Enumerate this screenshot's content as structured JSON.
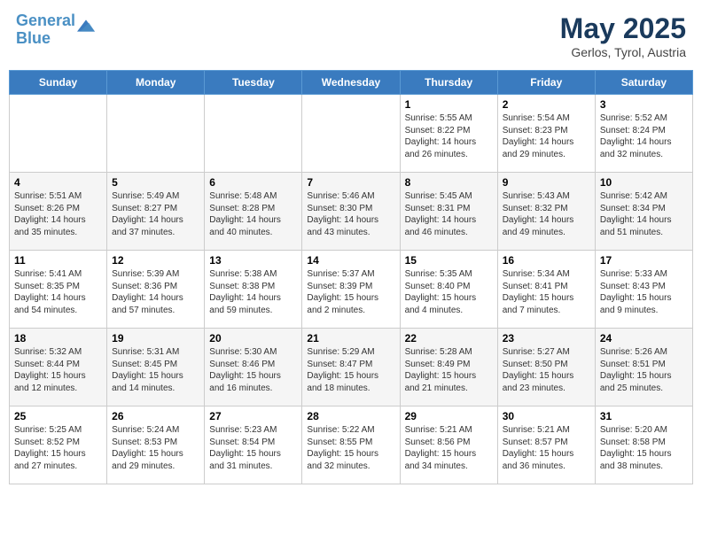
{
  "header": {
    "logo_line1": "General",
    "logo_line2": "Blue",
    "month": "May 2025",
    "location": "Gerlos, Tyrol, Austria"
  },
  "days_of_week": [
    "Sunday",
    "Monday",
    "Tuesday",
    "Wednesday",
    "Thursday",
    "Friday",
    "Saturday"
  ],
  "weeks": [
    [
      {
        "day": "",
        "info": ""
      },
      {
        "day": "",
        "info": ""
      },
      {
        "day": "",
        "info": ""
      },
      {
        "day": "",
        "info": ""
      },
      {
        "day": "1",
        "info": "Sunrise: 5:55 AM\nSunset: 8:22 PM\nDaylight: 14 hours and 26 minutes."
      },
      {
        "day": "2",
        "info": "Sunrise: 5:54 AM\nSunset: 8:23 PM\nDaylight: 14 hours and 29 minutes."
      },
      {
        "day": "3",
        "info": "Sunrise: 5:52 AM\nSunset: 8:24 PM\nDaylight: 14 hours and 32 minutes."
      }
    ],
    [
      {
        "day": "4",
        "info": "Sunrise: 5:51 AM\nSunset: 8:26 PM\nDaylight: 14 hours and 35 minutes."
      },
      {
        "day": "5",
        "info": "Sunrise: 5:49 AM\nSunset: 8:27 PM\nDaylight: 14 hours and 37 minutes."
      },
      {
        "day": "6",
        "info": "Sunrise: 5:48 AM\nSunset: 8:28 PM\nDaylight: 14 hours and 40 minutes."
      },
      {
        "day": "7",
        "info": "Sunrise: 5:46 AM\nSunset: 8:30 PM\nDaylight: 14 hours and 43 minutes."
      },
      {
        "day": "8",
        "info": "Sunrise: 5:45 AM\nSunset: 8:31 PM\nDaylight: 14 hours and 46 minutes."
      },
      {
        "day": "9",
        "info": "Sunrise: 5:43 AM\nSunset: 8:32 PM\nDaylight: 14 hours and 49 minutes."
      },
      {
        "day": "10",
        "info": "Sunrise: 5:42 AM\nSunset: 8:34 PM\nDaylight: 14 hours and 51 minutes."
      }
    ],
    [
      {
        "day": "11",
        "info": "Sunrise: 5:41 AM\nSunset: 8:35 PM\nDaylight: 14 hours and 54 minutes."
      },
      {
        "day": "12",
        "info": "Sunrise: 5:39 AM\nSunset: 8:36 PM\nDaylight: 14 hours and 57 minutes."
      },
      {
        "day": "13",
        "info": "Sunrise: 5:38 AM\nSunset: 8:38 PM\nDaylight: 14 hours and 59 minutes."
      },
      {
        "day": "14",
        "info": "Sunrise: 5:37 AM\nSunset: 8:39 PM\nDaylight: 15 hours and 2 minutes."
      },
      {
        "day": "15",
        "info": "Sunrise: 5:35 AM\nSunset: 8:40 PM\nDaylight: 15 hours and 4 minutes."
      },
      {
        "day": "16",
        "info": "Sunrise: 5:34 AM\nSunset: 8:41 PM\nDaylight: 15 hours and 7 minutes."
      },
      {
        "day": "17",
        "info": "Sunrise: 5:33 AM\nSunset: 8:43 PM\nDaylight: 15 hours and 9 minutes."
      }
    ],
    [
      {
        "day": "18",
        "info": "Sunrise: 5:32 AM\nSunset: 8:44 PM\nDaylight: 15 hours and 12 minutes."
      },
      {
        "day": "19",
        "info": "Sunrise: 5:31 AM\nSunset: 8:45 PM\nDaylight: 15 hours and 14 minutes."
      },
      {
        "day": "20",
        "info": "Sunrise: 5:30 AM\nSunset: 8:46 PM\nDaylight: 15 hours and 16 minutes."
      },
      {
        "day": "21",
        "info": "Sunrise: 5:29 AM\nSunset: 8:47 PM\nDaylight: 15 hours and 18 minutes."
      },
      {
        "day": "22",
        "info": "Sunrise: 5:28 AM\nSunset: 8:49 PM\nDaylight: 15 hours and 21 minutes."
      },
      {
        "day": "23",
        "info": "Sunrise: 5:27 AM\nSunset: 8:50 PM\nDaylight: 15 hours and 23 minutes."
      },
      {
        "day": "24",
        "info": "Sunrise: 5:26 AM\nSunset: 8:51 PM\nDaylight: 15 hours and 25 minutes."
      }
    ],
    [
      {
        "day": "25",
        "info": "Sunrise: 5:25 AM\nSunset: 8:52 PM\nDaylight: 15 hours and 27 minutes."
      },
      {
        "day": "26",
        "info": "Sunrise: 5:24 AM\nSunset: 8:53 PM\nDaylight: 15 hours and 29 minutes."
      },
      {
        "day": "27",
        "info": "Sunrise: 5:23 AM\nSunset: 8:54 PM\nDaylight: 15 hours and 31 minutes."
      },
      {
        "day": "28",
        "info": "Sunrise: 5:22 AM\nSunset: 8:55 PM\nDaylight: 15 hours and 32 minutes."
      },
      {
        "day": "29",
        "info": "Sunrise: 5:21 AM\nSunset: 8:56 PM\nDaylight: 15 hours and 34 minutes."
      },
      {
        "day": "30",
        "info": "Sunrise: 5:21 AM\nSunset: 8:57 PM\nDaylight: 15 hours and 36 minutes."
      },
      {
        "day": "31",
        "info": "Sunrise: 5:20 AM\nSunset: 8:58 PM\nDaylight: 15 hours and 38 minutes."
      }
    ]
  ]
}
